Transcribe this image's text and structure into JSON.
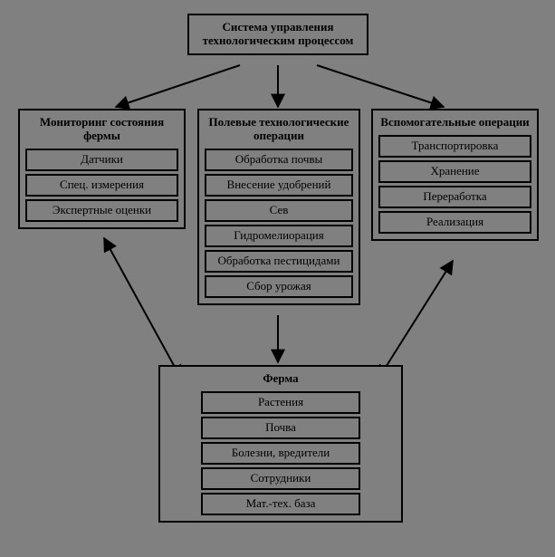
{
  "root": {
    "title": "Система управления технологическим процессом"
  },
  "monitoring": {
    "title": "Мониторинг состояния фермы",
    "items": [
      "Датчики",
      "Спец. измерения",
      "Экспертные оценки"
    ]
  },
  "field_ops": {
    "title": "Полевые технологические операции",
    "items": [
      "Обработка почвы",
      "Внесение удобрений",
      "Сев",
      "Гидромелиорация",
      "Обработка пестицидами",
      "Сбор урожая"
    ]
  },
  "aux_ops": {
    "title": "Вспомогательные операции",
    "items": [
      "Транспортировка",
      "Хранение",
      "Переработка",
      "Реализация"
    ]
  },
  "farm": {
    "title": "Ферма",
    "items": [
      "Растения",
      "Почва",
      "Болезни, вредители",
      "Сотрудники",
      "Мат.-тех. база"
    ]
  }
}
